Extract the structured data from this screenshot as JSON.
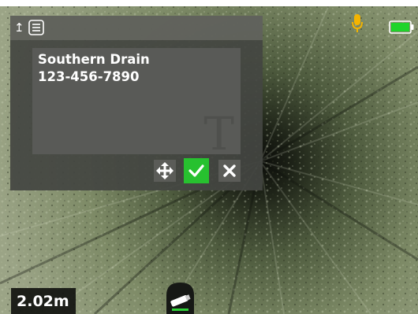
{
  "dialog": {
    "text_lines": [
      "Southern Drain",
      "123-456-7890"
    ],
    "watermark": "T"
  },
  "icons": {
    "up": "up-arrow-icon",
    "list": "list-icon",
    "move": "move-icon",
    "confirm": "check-icon",
    "cancel": "close-icon",
    "microphone": "microphone-icon",
    "battery": "battery-icon",
    "camera": "camera-head-icon"
  },
  "status": {
    "distance": "2.02m",
    "battery_level": 1.0
  },
  "colors": {
    "confirm": "#27c12f",
    "battery": "#1fd42b",
    "microphone": "#f4b400"
  }
}
